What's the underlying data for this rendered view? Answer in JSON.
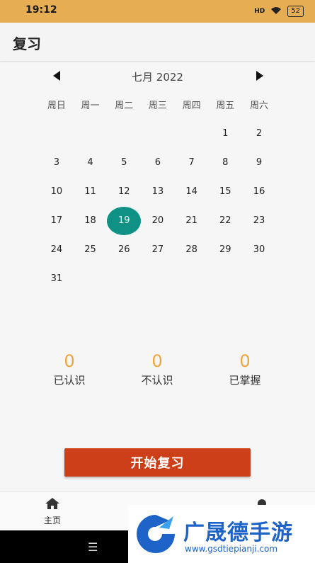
{
  "status": {
    "time": "19:12",
    "signal": "HD",
    "battery": "52"
  },
  "appbar": {
    "title": "复习"
  },
  "calendar": {
    "month_label": "七月 2022",
    "weekdays": [
      "周日",
      "周一",
      "周二",
      "周三",
      "周四",
      "周五",
      "周六"
    ],
    "days": [
      "",
      "",
      "",
      "",
      "",
      "1",
      "2",
      "3",
      "4",
      "5",
      "6",
      "7",
      "8",
      "9",
      "10",
      "11",
      "12",
      "13",
      "14",
      "15",
      "16",
      "17",
      "18",
      "19",
      "20",
      "21",
      "22",
      "23",
      "24",
      "25",
      "26",
      "27",
      "28",
      "29",
      "30",
      "31"
    ],
    "selected": "19",
    "accent": "#0f9186"
  },
  "stats": [
    {
      "value": "0",
      "label": "已认识"
    },
    {
      "value": "0",
      "label": "不认识"
    },
    {
      "value": "0",
      "label": "已掌握"
    }
  ],
  "start_button": {
    "label": "开始复习",
    "color": "#cc3f18"
  },
  "bottom_nav": {
    "home_label": "主页"
  },
  "watermark": {
    "title": "广晟德手游",
    "url": "www.gsdtiepianji.com"
  },
  "colors": {
    "status_bar": "#e6ad52",
    "stat_number": "#f0a43c"
  }
}
